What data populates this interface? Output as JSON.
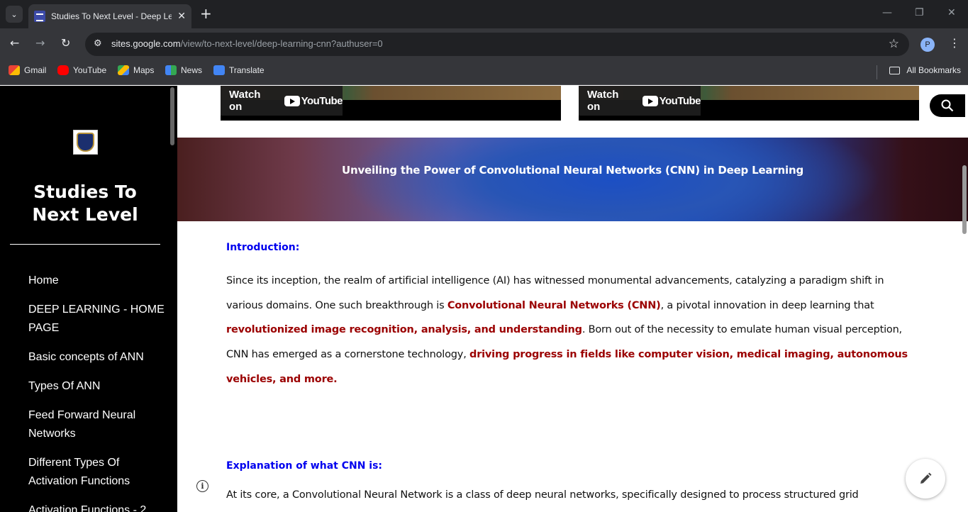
{
  "browser": {
    "tab_title": "Studies To Next Level - Deep Le",
    "url_host": "sites.google.com",
    "url_path": "/view/to-next-level/deep-learning-cnn?authuser=0",
    "profile_initial": "P",
    "bookmarks": [
      {
        "label": "Gmail",
        "icon": "gmail-icon",
        "color": "#ea4335"
      },
      {
        "label": "YouTube",
        "icon": "youtube-icon",
        "color": "#ff0000"
      },
      {
        "label": "Maps",
        "icon": "maps-icon",
        "color": "#34a853"
      },
      {
        "label": "News",
        "icon": "news-icon",
        "color": "#4285f4"
      },
      {
        "label": "Translate",
        "icon": "translate-icon",
        "color": "#4285f4"
      }
    ],
    "all_bookmarks_label": "All Bookmarks"
  },
  "sidebar": {
    "site_title": "Studies To Next Level",
    "nav": [
      "Home",
      "DEEP LEARNING - HOME PAGE",
      "Basic concepts of ANN",
      "Types Of ANN",
      "Feed Forward Neural Networks",
      "Different Types Of Activation Functions",
      "Activation Functions - 2"
    ]
  },
  "videos": [
    {
      "watch_label": "Watch on",
      "brand": "YouTube"
    },
    {
      "watch_label": "Watch on",
      "brand": "YouTube"
    }
  ],
  "hero": {
    "title": "Unveiling the Power of Convolutional Neural Networks (CNN) in Deep Learning"
  },
  "article": {
    "intro_heading": "Introduction:",
    "intro_p1": "Since its inception, the realm of artificial intelligence (AI) has witnessed monumental advancements, catalyzing a paradigm shift in various domains. One such breakthrough is ",
    "intro_hl1": "Convolutional Neural Networks (CNN)",
    "intro_p2": ", a pivotal innovation in deep learning that ",
    "intro_hl2": "revolutionized image recognition, analysis, and understanding",
    "intro_p3": ". Born out of the necessity to emulate human visual perception, CNN has emerged as a cornerstone technology, ",
    "intro_hl3": "driving progress in fields like computer vision, medical imaging, autonomous vehicles, and more",
    "intro_p4": ".",
    "explain_heading": "Explanation of what CNN is:",
    "explain_p1": "At its core, a Convolutional Neural Network is a class of deep neural networks, specifically designed to process structured grid"
  }
}
